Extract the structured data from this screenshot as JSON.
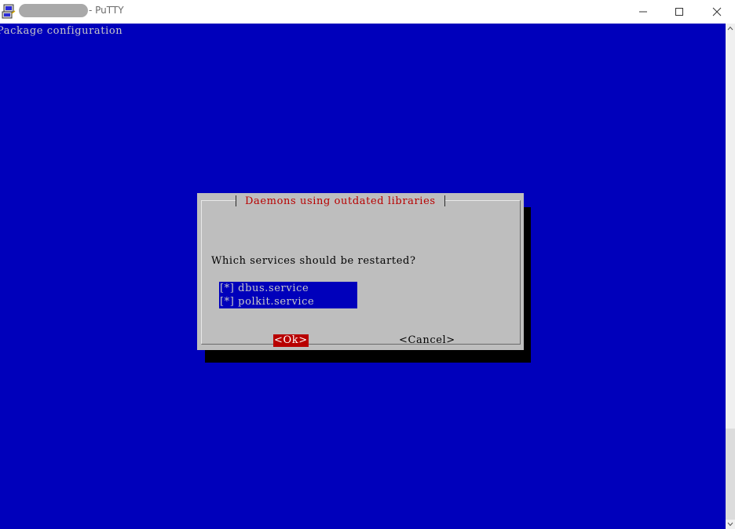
{
  "window": {
    "app_name": "- PuTTY",
    "icon": "putty-icon",
    "controls": {
      "minimize": "minimize-icon",
      "maximize": "maximize-icon",
      "close": "close-icon"
    }
  },
  "terminal": {
    "background_color": "#0000bb",
    "header_line": "Package configuration"
  },
  "dialog": {
    "title": "Daemons using outdated libraries",
    "question": "Which services should be restarted?",
    "options": [
      {
        "label": "[*] dbus.service"
      },
      {
        "label": "[*] polkit.service"
      }
    ],
    "ok_label": "<Ok>",
    "cancel_label": "<Cancel>",
    "title_color": "#b80000",
    "ok_highlight_color": "#b80000"
  }
}
